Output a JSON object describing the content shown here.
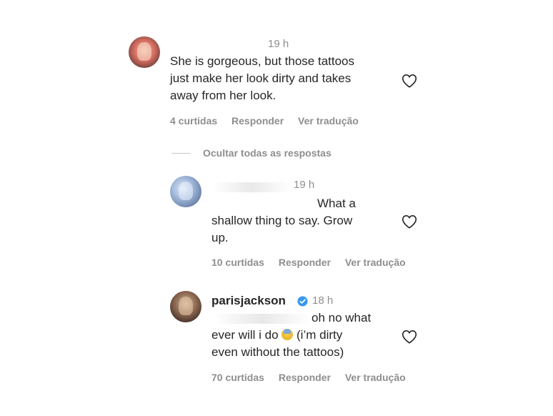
{
  "comment1": {
    "time": "19 h",
    "lines": [
      "She is gorgeous, but those tattoos",
      "just make her look dirty and takes",
      "away from her look."
    ],
    "likes": "4 curtidas",
    "reply": "Responder",
    "translate": "Ver tradução"
  },
  "hide_replies": "Ocultar todas as respostas",
  "reply1": {
    "time": "19 h",
    "lines": [
      "What a",
      "shallow thing to say. Grow",
      "up."
    ],
    "likes": "10 curtidas",
    "reply": "Responder",
    "translate": "Ver tradução"
  },
  "reply2": {
    "username": "parisjackson",
    "time": "18 h",
    "lines": [
      "oh no what",
      "ever will i do",
      "(i’m dirty",
      "even without the tattoos)"
    ],
    "emoji": "anxious-face-emoji",
    "likes": "70 curtidas",
    "reply": "Responder",
    "translate": "Ver tradução"
  },
  "colors": {
    "text": "#262626",
    "secondary": "#8e8e8e",
    "verified": "#3897f0"
  }
}
